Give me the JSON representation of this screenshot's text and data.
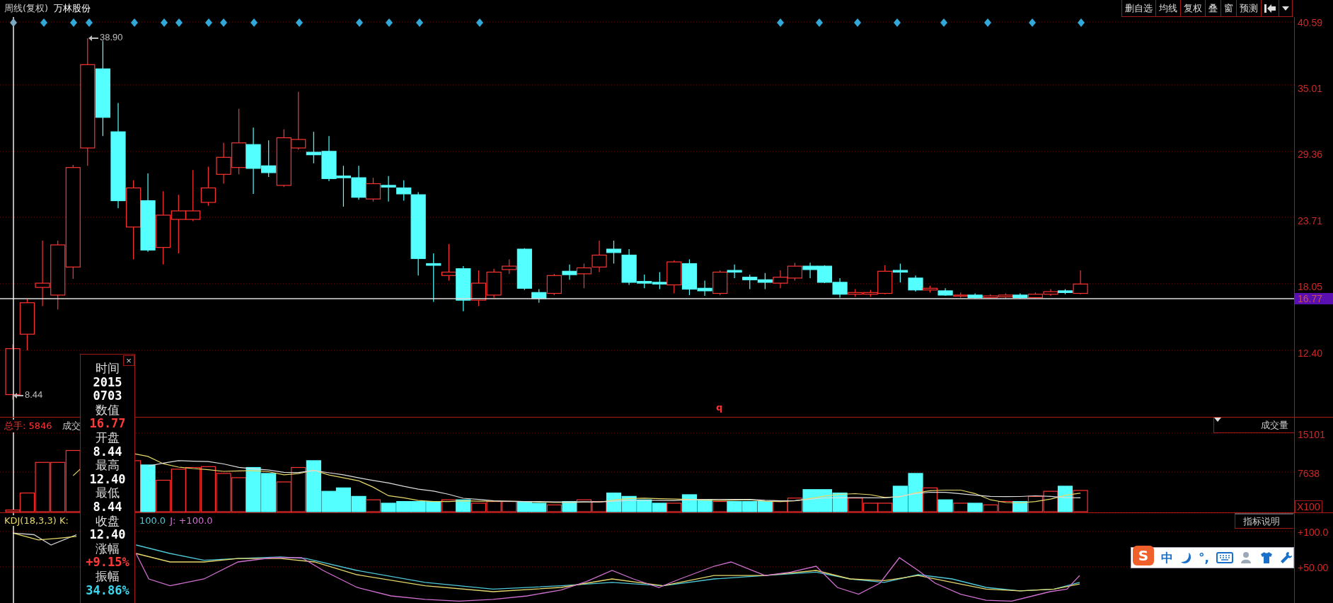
{
  "title": {
    "period": "周线(复权)",
    "stock": "万林股份"
  },
  "toolbar": [
    {
      "label": "删自选"
    },
    {
      "label": "均线"
    },
    {
      "label": "复权"
    },
    {
      "label": "叠"
    },
    {
      "label": "窗"
    },
    {
      "label": "预测"
    }
  ],
  "price_axis": [
    {
      "kind": "tick",
      "label": "40.59"
    },
    {
      "kind": "tick",
      "label": "35.01"
    },
    {
      "kind": "tick",
      "label": "29.36"
    },
    {
      "kind": "tick",
      "label": "23.71"
    },
    {
      "kind": "tick",
      "label": "18.05"
    },
    {
      "kind": "current",
      "label": "16.77"
    },
    {
      "kind": "tick",
      "label": "12.40"
    }
  ],
  "price_marks": [
    {
      "kind": "high",
      "label": "38.90"
    },
    {
      "kind": "low",
      "label": "8.44"
    }
  ],
  "cursor_mark": "q",
  "volume": {
    "header": [
      {
        "kind": "total",
        "text": "总手: 5846"
      },
      {
        "kind": "name",
        "text": "成交"
      }
    ],
    "tab": "成交量",
    "axis": [
      "15101",
      "7638"
    ],
    "unit": "X100"
  },
  "kdj": {
    "header": [
      {
        "kind": "name",
        "text": "KDJ(18,3,3) K:"
      },
      {
        "kind": "d",
        "text": "100.0"
      },
      {
        "kind": "j",
        "text": "J: +100.0"
      }
    ],
    "button": "指标说明",
    "axis": [
      "+100.0",
      "+50.00"
    ]
  },
  "info_panel": {
    "close": "×",
    "rows": [
      {
        "kind": "label",
        "text": "时间"
      },
      {
        "kind": "value",
        "text": "2015"
      },
      {
        "kind": "value",
        "text": "0703"
      },
      {
        "kind": "label",
        "text": "数值"
      },
      {
        "kind": "up",
        "text": "16.77"
      },
      {
        "kind": "label",
        "text": "开盘"
      },
      {
        "kind": "value",
        "text": "8.44"
      },
      {
        "kind": "label",
        "text": "最高"
      },
      {
        "kind": "value",
        "text": "12.40"
      },
      {
        "kind": "label",
        "text": "最低"
      },
      {
        "kind": "value",
        "text": "8.44"
      },
      {
        "kind": "label",
        "text": "收盘"
      },
      {
        "kind": "value",
        "text": "12.40"
      },
      {
        "kind": "label",
        "text": "涨幅"
      },
      {
        "kind": "up",
        "text": "+9.15%"
      },
      {
        "kind": "label",
        "text": "振幅"
      },
      {
        "kind": "range",
        "text": "34.86%"
      }
    ]
  },
  "ime_bar": {
    "logo": "S",
    "mode": "中",
    "punctuation": "°,"
  }
}
